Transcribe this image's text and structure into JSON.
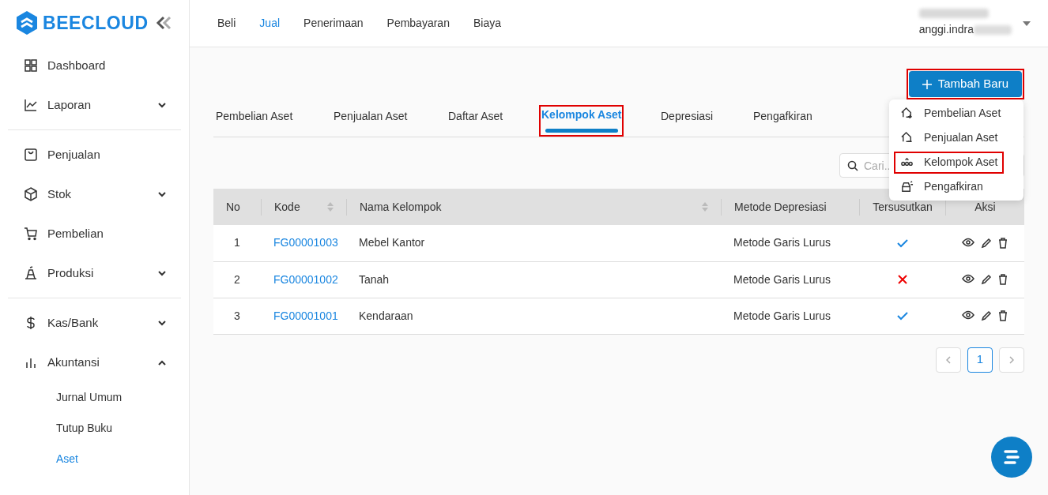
{
  "brand": "BEECLOUD",
  "sidebar": {
    "groups": [
      [
        {
          "label": "Dashboard"
        },
        {
          "label": "Laporan",
          "expanded": false
        }
      ],
      [
        {
          "label": "Penjualan"
        },
        {
          "label": "Stok",
          "expanded": false
        },
        {
          "label": "Pembelian"
        },
        {
          "label": "Produksi",
          "expanded": false
        }
      ],
      [
        {
          "label": "Kas/Bank",
          "expanded": false
        },
        {
          "label": "Akuntansi",
          "expanded": true,
          "children": [
            {
              "label": "Jurnal Umum",
              "selected": false
            },
            {
              "label": "Tutup Buku",
              "selected": false
            },
            {
              "label": "Aset",
              "selected": true
            }
          ]
        }
      ]
    ]
  },
  "top_nav": [
    {
      "label": "Beli",
      "selected": false
    },
    {
      "label": "Jual",
      "selected": true
    },
    {
      "label": "Penerimaan",
      "selected": false
    },
    {
      "label": "Pembayaran",
      "selected": false
    },
    {
      "label": "Biaya",
      "selected": false
    }
  ],
  "user": {
    "email": "anggi.indra"
  },
  "add_button": {
    "label": "Tambah Baru",
    "highlighted": true
  },
  "tabs": [
    {
      "label": "Pembelian Aset",
      "selected": false,
      "highlighted": false
    },
    {
      "label": "Penjualan Aset",
      "selected": false,
      "highlighted": false
    },
    {
      "label": "Daftar Aset",
      "selected": false,
      "highlighted": false
    },
    {
      "label": "Kelompok Aset",
      "selected": true,
      "highlighted": true
    },
    {
      "label": "Depresiasi",
      "selected": false,
      "highlighted": false
    },
    {
      "label": "Pengafkiran",
      "selected": false,
      "highlighted": false
    }
  ],
  "search": {
    "placeholder": "Cari.."
  },
  "table": {
    "columns": [
      {
        "label": "No",
        "sortable": false
      },
      {
        "label": "Kode",
        "sortable": true
      },
      {
        "label": "Nama Kelompok",
        "sortable": true
      },
      {
        "label": "Metode Depresiasi",
        "sortable": false
      },
      {
        "label": "Tersusutkan",
        "sortable": false
      },
      {
        "label": "Aksi",
        "sortable": false
      }
    ],
    "rows": [
      {
        "no": "1",
        "code": "FG00001003",
        "name": "Mebel Kantor",
        "method": "Metode Garis Lurus",
        "depreciated": true
      },
      {
        "no": "2",
        "code": "FG00001002",
        "name": "Tanah",
        "method": "Metode Garis Lurus",
        "depreciated": false
      },
      {
        "no": "3",
        "code": "FG00001001",
        "name": "Kendaraan",
        "method": "Metode Garis Lurus",
        "depreciated": true
      }
    ]
  },
  "pagination": {
    "pages": [
      {
        "label": "1",
        "selected": true
      }
    ]
  },
  "dropdown": {
    "items": [
      {
        "label": "Pembelian Aset",
        "highlighted": false
      },
      {
        "label": "Penjualan Aset",
        "highlighted": false
      },
      {
        "label": "Kelompok Aset",
        "highlighted": true
      },
      {
        "label": "Pengafkiran",
        "highlighted": false
      }
    ]
  }
}
